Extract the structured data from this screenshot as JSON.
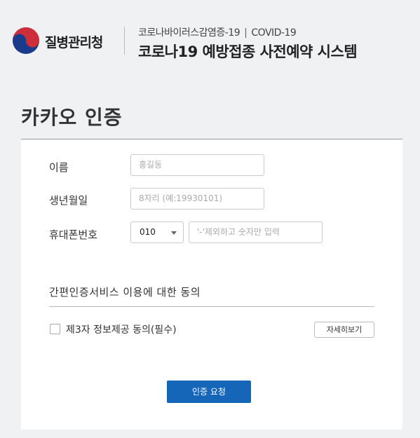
{
  "header": {
    "org_name": "질병관리청",
    "subtitle_ko": "코로나바이러스감염증-19",
    "subtitle_sep": "|",
    "subtitle_en": "COVID-19",
    "system_title": "코로나19 예방접종 사전예약 시스템"
  },
  "page_title": "카카오 인증",
  "form": {
    "name_label": "이름",
    "name_placeholder": "홍길동",
    "birth_label": "생년월일",
    "birth_placeholder": "8자리 (예:19930101)",
    "phone_label": "휴대폰번호",
    "carrier_value": "010",
    "phone_placeholder": "'-'제외하고 숫자만 입력"
  },
  "consent": {
    "section_title": "간편인증서비스 이용에 대한 동의",
    "item_label": "제3자 정보제공 동의(필수)",
    "item_checked": false,
    "detail_button": "자세히보기"
  },
  "submit_label": "인증 요청",
  "colors": {
    "primary": "#1565b8",
    "logo_red": "#cd2e3a",
    "logo_blue": "#1a3a8c"
  }
}
